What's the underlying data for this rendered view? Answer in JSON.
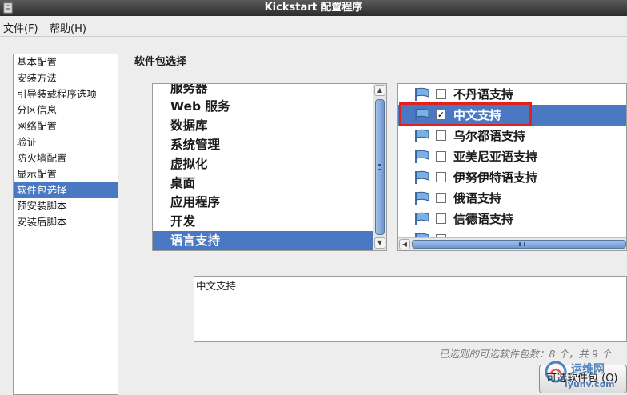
{
  "window": {
    "title": "Kickstart 配置程序",
    "icon": "app-window-icon"
  },
  "menubar": {
    "file": "文件(F)",
    "help": "帮助(H)"
  },
  "sidebar": {
    "items": [
      {
        "label": "基本配置"
      },
      {
        "label": "安装方法"
      },
      {
        "label": "引导装载程序选项"
      },
      {
        "label": "分区信息"
      },
      {
        "label": "网络配置"
      },
      {
        "label": "验证"
      },
      {
        "label": "防火墙配置"
      },
      {
        "label": "显示配置"
      },
      {
        "label": "软件包选择",
        "selected": true
      },
      {
        "label": "预安装脚本"
      },
      {
        "label": "安装后脚本"
      }
    ]
  },
  "main": {
    "section_title": "软件包选择",
    "groups": [
      {
        "label": "服务器"
      },
      {
        "label": "Web 服务"
      },
      {
        "label": "数据库"
      },
      {
        "label": "系统管理"
      },
      {
        "label": "虚拟化"
      },
      {
        "label": "桌面"
      },
      {
        "label": "应用程序"
      },
      {
        "label": "开发"
      },
      {
        "label": "语言支持",
        "selected": true
      }
    ],
    "packages": [
      {
        "label": "不丹语支持",
        "checked": false
      },
      {
        "label": "中文支持",
        "checked": true,
        "selected": true
      },
      {
        "label": "乌尔都语支持",
        "checked": false
      },
      {
        "label": "亚美尼亚语支持",
        "checked": false
      },
      {
        "label": "伊努伊特语支持",
        "checked": false
      },
      {
        "label": "俄语支持",
        "checked": false
      },
      {
        "label": "信德语支持",
        "checked": false
      },
      {
        "label": "",
        "checked": false
      }
    ],
    "description": "中文支持",
    "count_text": "已选则的可选软件包数：8 个，共 9 个",
    "optional_button": "可选软件包 (O)"
  },
  "watermark": {
    "line1": "运维网",
    "line2": "iyunv.com"
  },
  "colors": {
    "selection": "#4a78c2",
    "highlight_border": "#e0211e"
  }
}
